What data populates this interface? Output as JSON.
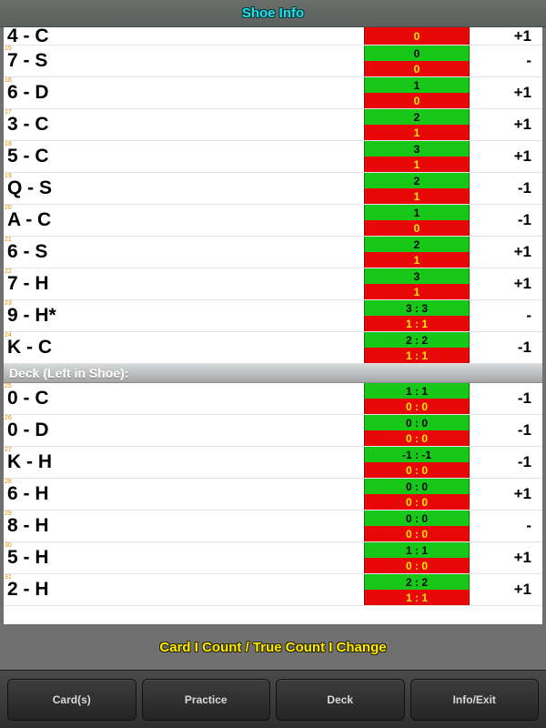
{
  "header": {
    "title": "Shoe Info"
  },
  "legend": "Card I Count / True Count I Change",
  "section_header": "Deck (Left in Shoe):",
  "top_rows": [
    {
      "idx": "",
      "card": "4 - C",
      "top": "",
      "bot": "0",
      "change": "+1"
    },
    {
      "idx": "15",
      "card": "7 - S",
      "top": "0",
      "bot": "0",
      "change": "-"
    },
    {
      "idx": "16",
      "card": "6 - D",
      "top": "1",
      "bot": "0",
      "change": "+1"
    },
    {
      "idx": "17",
      "card": "3 - C",
      "top": "2",
      "bot": "1",
      "change": "+1"
    },
    {
      "idx": "18",
      "card": "5 - C",
      "top": "3",
      "bot": "1",
      "change": "+1"
    },
    {
      "idx": "19",
      "card": "Q - S",
      "top": "2",
      "bot": "1",
      "change": "-1"
    },
    {
      "idx": "20",
      "card": "A - C",
      "top": "1",
      "bot": "0",
      "change": "-1"
    },
    {
      "idx": "21",
      "card": "6 - S",
      "top": "2",
      "bot": "1",
      "change": "+1"
    },
    {
      "idx": "22",
      "card": "7 - H",
      "top": "3",
      "bot": "1",
      "change": "+1"
    },
    {
      "idx": "23",
      "card": "9 - H*",
      "top": "3 : 3",
      "bot": "1 : 1",
      "change": "-"
    },
    {
      "idx": "24",
      "card": "K - C",
      "top": "2 : 2",
      "bot": "1 : 1",
      "change": "-1"
    }
  ],
  "bottom_rows": [
    {
      "idx": "25",
      "card": "0 - C",
      "top": "1 : 1",
      "bot": "0 : 0",
      "change": "-1"
    },
    {
      "idx": "26",
      "card": "0 - D",
      "top": "0 : 0",
      "bot": "0 : 0",
      "change": "-1"
    },
    {
      "idx": "27",
      "card": "K - H",
      "top": "-1 : -1",
      "bot": "0 : 0",
      "change": "-1"
    },
    {
      "idx": "28",
      "card": "6 - H",
      "top": "0 : 0",
      "bot": "0 : 0",
      "change": "+1"
    },
    {
      "idx": "29",
      "card": "8 - H",
      "top": "0 : 0",
      "bot": "0 : 0",
      "change": "-"
    },
    {
      "idx": "30",
      "card": "5 - H",
      "top": "1 : 1",
      "bot": "0 : 0",
      "change": "+1"
    },
    {
      "idx": "31",
      "card": "2 - H",
      "top": "2 : 2",
      "bot": "1 : 1",
      "change": "+1"
    }
  ],
  "tabs": {
    "cards": "Card(s)",
    "practice": "Practice",
    "deck": "Deck",
    "info": "Info/Exit"
  },
  "first_row_top_hidden": true
}
